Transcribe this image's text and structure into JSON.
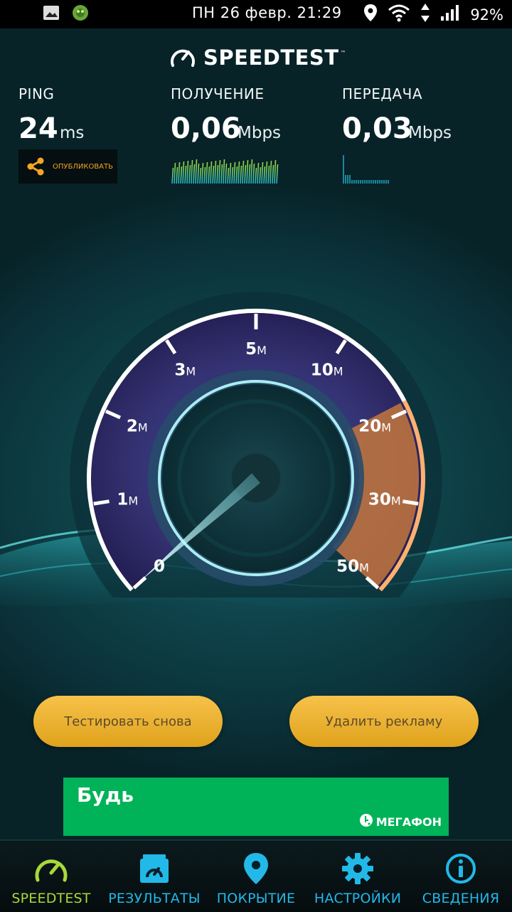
{
  "status_bar": {
    "clock": "ПН 26 февр. 21:29",
    "battery": "92%",
    "icons": [
      "image-icon",
      "app-icon",
      "location-icon",
      "wifi-icon",
      "data-arrows-icon",
      "signal-icon"
    ]
  },
  "header": {
    "logo": "SPEEDTEST",
    "logo_tm": "™"
  },
  "metrics": {
    "ping": {
      "label": "PING",
      "value": "24",
      "unit": "ms"
    },
    "download": {
      "label": "ПОЛУЧЕНИЕ",
      "value": "0,06",
      "unit": "Mbps"
    },
    "upload": {
      "label": "ПЕРЕДАЧА",
      "value": "0,03",
      "unit": "Mbps"
    },
    "share_label": "ОПУБЛИКОВАТЬ"
  },
  "gauge": {
    "ticks": [
      {
        "num": "0",
        "unit": ""
      },
      {
        "num": "1",
        "unit": "M"
      },
      {
        "num": "2",
        "unit": "M"
      },
      {
        "num": "3",
        "unit": "M"
      },
      {
        "num": "5",
        "unit": "M"
      },
      {
        "num": "10",
        "unit": "M"
      },
      {
        "num": "20",
        "unit": "M"
      },
      {
        "num": "30",
        "unit": "M"
      },
      {
        "num": "50",
        "unit": "M"
      }
    ],
    "needle_value_mbps": 0.03
  },
  "actions": {
    "retest": "Тестировать снова",
    "remove_ads": "Удалить рекламу"
  },
  "ad": {
    "headline": "Будь",
    "brand": "МЕГАФОН"
  },
  "nav": [
    {
      "label": "SPEEDTEST",
      "icon": "speedometer-icon",
      "active": true
    },
    {
      "label": "РЕЗУЛЬТАТЫ",
      "icon": "results-icon",
      "active": false
    },
    {
      "label": "ПОКРЫТИЕ",
      "icon": "map-pin-icon",
      "active": false
    },
    {
      "label": "НАСТРОЙКИ",
      "icon": "gear-icon",
      "active": false
    },
    {
      "label": "СВЕДЕНИЯ",
      "icon": "info-icon",
      "active": false
    }
  ],
  "colors": {
    "accent_orange": "#f5a623",
    "nav_active": "#a8d93a",
    "nav_inactive": "#22b9e8",
    "ad_green": "#00b358"
  }
}
